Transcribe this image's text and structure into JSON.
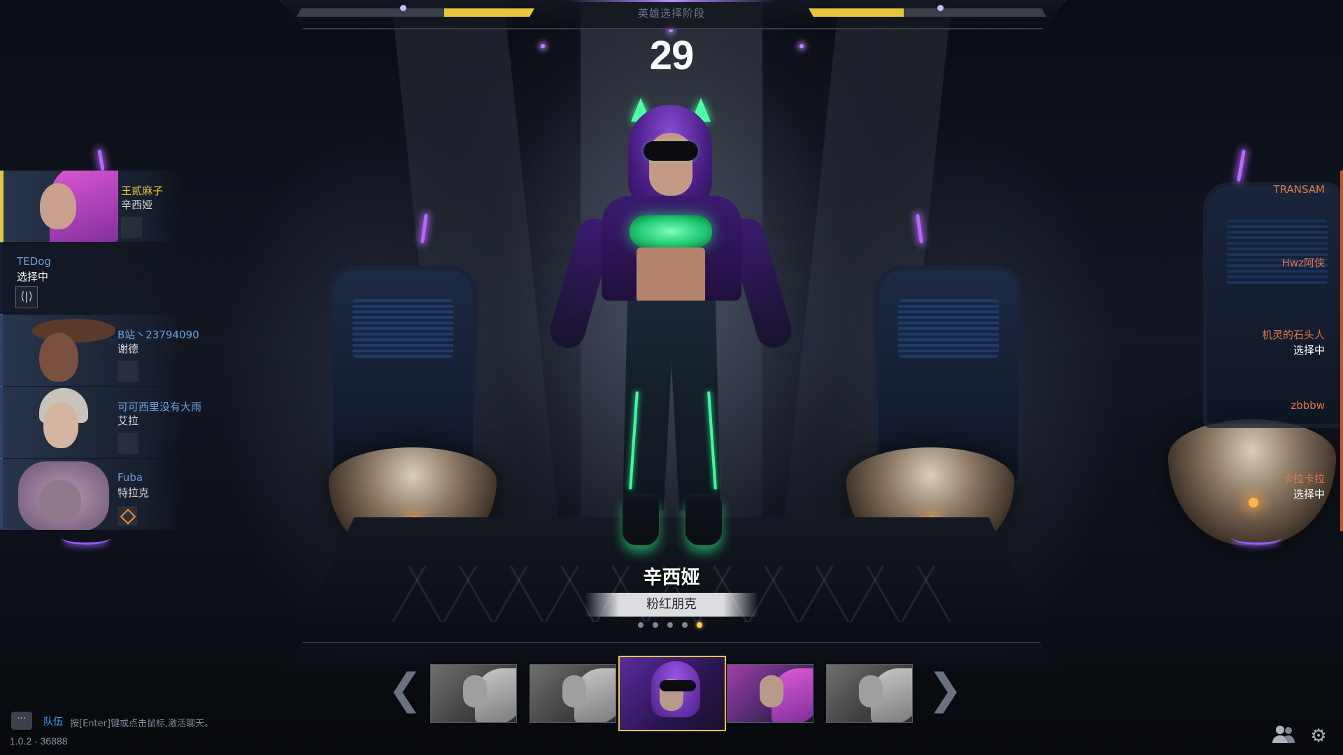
{
  "top_bar": {
    "phase_label": "英雄选择阶段",
    "timer": "29",
    "left_progress": 0.38,
    "right_progress": 0.4
  },
  "left_team": [
    {
      "player": "王贰麻子",
      "hero": "辛西娅",
      "name_color": "#e6c73c",
      "state": "locked"
    },
    {
      "player": "TEDog",
      "hero": "选择中",
      "name_color": "#6da0d9",
      "state": "picking"
    },
    {
      "player": "B站丶23794090",
      "hero": "谢德",
      "name_color": "#6da0d9",
      "state": "locked"
    },
    {
      "player": "可可西里没有大雨",
      "hero": "艾拉",
      "name_color": "#6da0d9",
      "state": "locked"
    },
    {
      "player": "Fuba",
      "hero": "特拉克",
      "name_color": "#6da0d9",
      "state": "locked"
    }
  ],
  "right_team": [
    {
      "player": "TRANSAM",
      "status": ""
    },
    {
      "player": "Hwz阿侠",
      "status": ""
    },
    {
      "player": "机灵的石头人",
      "status": "选择中"
    },
    {
      "player": "zbbbw",
      "status": ""
    },
    {
      "player": "卡拉卡拉",
      "status": "选择中"
    }
  ],
  "hero": {
    "name": "辛西娅",
    "skin_name": "粉红朋克",
    "skin_count": 5,
    "skin_selected_index": 4
  },
  "carousel": {
    "prev_arrow": "❮",
    "next_arrow": "❯",
    "thumbs": [
      {
        "style": "gray"
      },
      {
        "style": "gray"
      },
      {
        "style": "selected"
      },
      {
        "style": "colored"
      },
      {
        "style": "gray"
      }
    ]
  },
  "chat": {
    "icon": "chat-bubble-icon",
    "channel": "队伍",
    "hint": "按[Enter]键或点击鼠标,激活聊天。"
  },
  "version": "1.0.2 - 36888",
  "icons": {
    "friends": "friends-icon",
    "settings": "gear-icon",
    "swap": "swap-icon",
    "diamond": "diamond-icon"
  },
  "colors": {
    "accent_yellow": "#e6c73c",
    "ally_blue": "#6da0d9",
    "enemy_orange": "#e0794a",
    "neon_purple": "#b867ff",
    "neon_green": "#3dff9a"
  }
}
